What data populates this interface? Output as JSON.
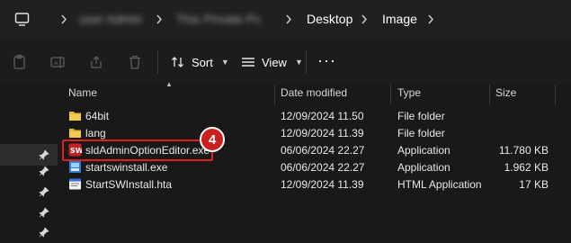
{
  "breadcrumb": {
    "items": [
      "user Admin",
      "This Private Pc",
      "Desktop",
      "Image"
    ]
  },
  "commandbar": {
    "sort_label": "Sort",
    "view_label": "View",
    "more_label": "···"
  },
  "columns": {
    "name": "Name",
    "date": "Date modified",
    "type": "Type",
    "size": "Size"
  },
  "files": [
    {
      "name": "64bit",
      "date": "12/09/2024 11.50",
      "type": "File folder",
      "size": "",
      "icon": "folder-icon"
    },
    {
      "name": "lang",
      "date": "12/09/2024 11.39",
      "type": "File folder",
      "size": "",
      "icon": "folder-icon"
    },
    {
      "name": "sldAdminOptionEditor.exe",
      "date": "06/06/2024 22.27",
      "type": "Application",
      "size": "11.780 KB",
      "icon": "solidworks-app-icon"
    },
    {
      "name": "startswinstall.exe",
      "date": "06/06/2024 22.27",
      "type": "Application",
      "size": "1.962 KB",
      "icon": "installer-app-icon"
    },
    {
      "name": "StartSWInstall.hta",
      "date": "12/09/2024 11.39",
      "type": "HTML Application",
      "size": "17 KB",
      "icon": "hta-file-icon"
    }
  ],
  "annotation": {
    "badge": "4"
  },
  "colors": {
    "folder": "#e8b53b",
    "highlight": "#e0201c",
    "badge": "#c8201d"
  }
}
